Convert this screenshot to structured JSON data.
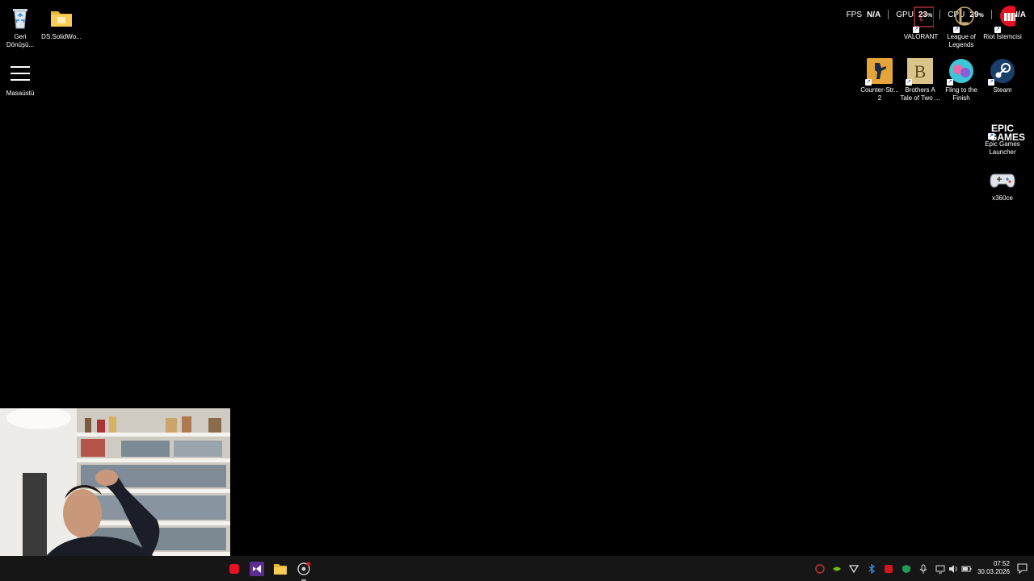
{
  "desktop": {
    "left_icons": [
      {
        "id": "recycle-bin",
        "label": "Geri\nDönüşü..."
      },
      {
        "id": "ds-solidworks",
        "label": "DS.SolidWo..."
      },
      {
        "id": "masaustu",
        "label": "Masaüstü"
      }
    ],
    "right_icons": [
      {
        "id": "valorant",
        "label": "VALORANT"
      },
      {
        "id": "league",
        "label": "League of\nLegends"
      },
      {
        "id": "riot",
        "label": "Riot İstemcisi"
      },
      {
        "id": "cs2",
        "label": "Counter-Str...\n2"
      },
      {
        "id": "brothers",
        "label": "Brothers A\nTale of Two ..."
      },
      {
        "id": "fling",
        "label": "Fling to the\nFinish"
      },
      {
        "id": "steam",
        "label": "Steam"
      },
      {
        "id": "epic",
        "label": "Epic Games\nLauncher",
        "logo_text": "EPIC\nGAMES"
      },
      {
        "id": "x360ce",
        "label": "x360ce"
      }
    ]
  },
  "overlay": {
    "fps_label": "FPS",
    "fps_value": "N/A",
    "gpu_label": "GPU",
    "gpu_value": "23",
    "cpu_label": "CPU",
    "cpu_value": "29",
    "ram_value": "N/A",
    "percent": "%"
  },
  "taskbar": {
    "apps": [
      "red-app-icon",
      "visual-studio-icon",
      "file-explorer-icon",
      "chrome-like-icon"
    ],
    "tray": [
      "shield-icon",
      "nvidia-icon",
      "wifi-triangle-icon",
      "bluetooth-icon",
      "red-square-icon",
      "defender-icon",
      "microphone-icon",
      "display-icon",
      "volume-icon",
      "battery-icon"
    ],
    "time": "07:52",
    "date": "30.03.2026"
  },
  "colors": {
    "taskbar": "#161616",
    "desktop": "#000000",
    "accent_red": "#e81123"
  }
}
